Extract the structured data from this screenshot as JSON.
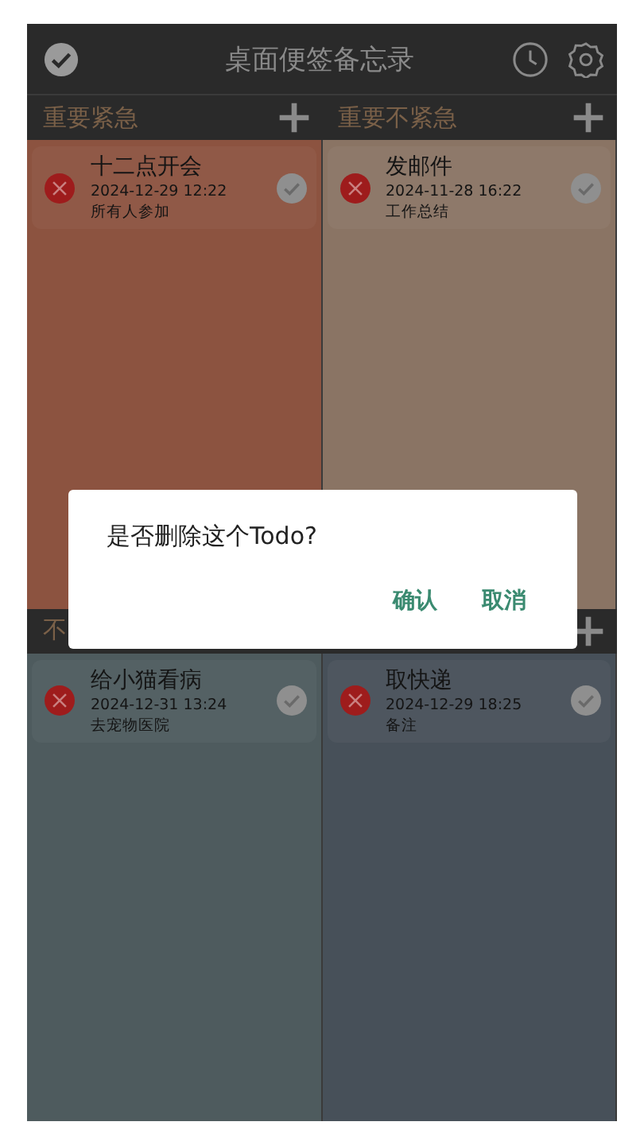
{
  "app_bar": {
    "title": "桌面便签备忘录"
  },
  "quadrants": [
    {
      "title": "重要紧急",
      "add_button": true,
      "color": "#8c5340",
      "cards": [
        {
          "title": "十二点开会",
          "time": "2024-12-29 12:22",
          "note": "所有人参加"
        }
      ]
    },
    {
      "title": "重要不紧急",
      "add_button": true,
      "color": "#8a7464",
      "cards": [
        {
          "title": "发邮件",
          "time": "2024-11-28 16:22",
          "note": "工作总结"
        }
      ]
    },
    {
      "title": "不",
      "color": "#4e5b5e",
      "cards": [
        {
          "title": "给小猫看病",
          "time": "2024-12-31 13:24",
          "note": "去宠物医院"
        }
      ]
    },
    {
      "add_button": true,
      "color": "#475059",
      "cards": [
        {
          "title": "取快递",
          "time": "2024-12-29 18:25",
          "note": "备注"
        }
      ]
    }
  ],
  "dialog": {
    "message": "是否删除这个Todo?",
    "buttons": [
      "确认",
      "取消"
    ]
  }
}
